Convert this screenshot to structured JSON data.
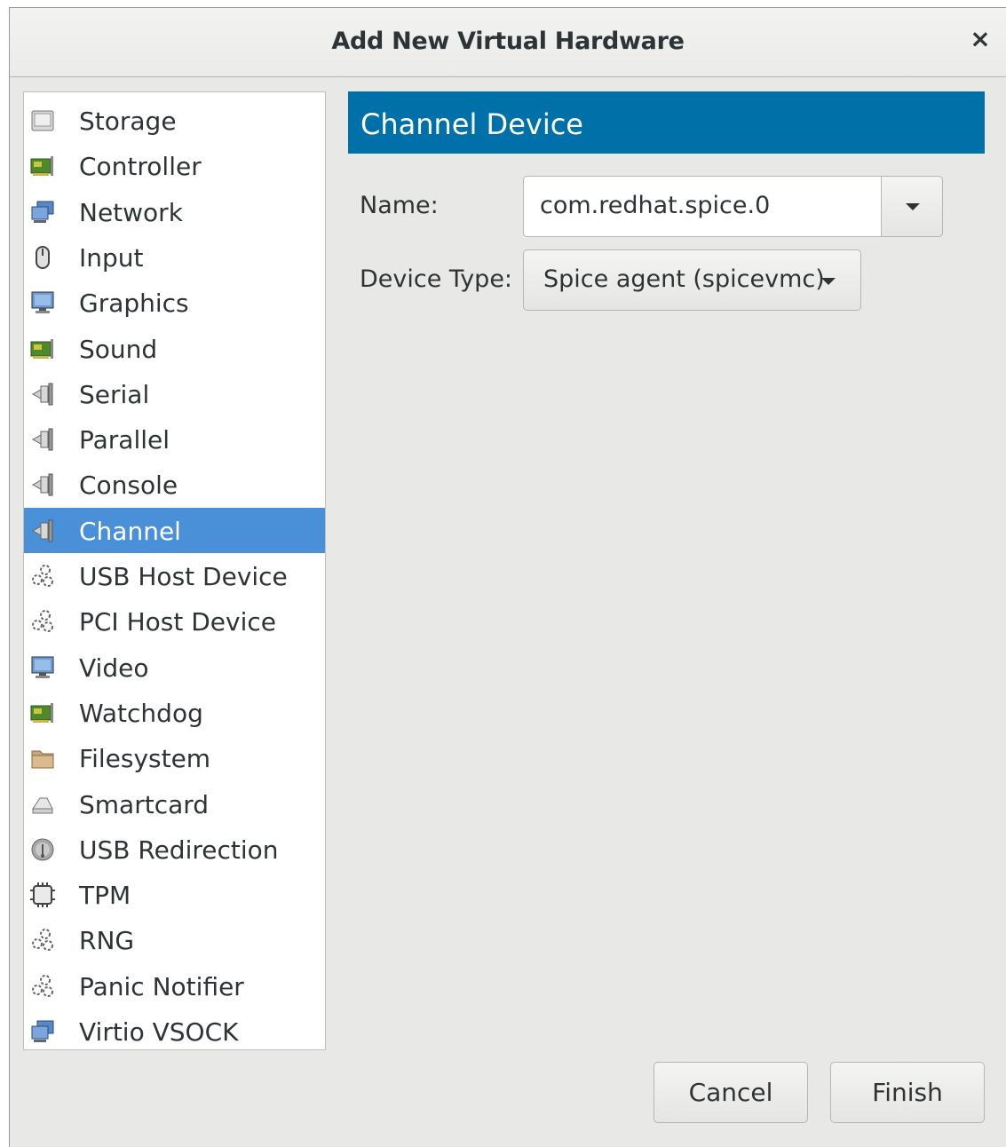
{
  "window": {
    "title": "Add New Virtual Hardware",
    "close_glyph": "×"
  },
  "hardware_list": {
    "selected_index": 9,
    "items": [
      {
        "label": "Storage",
        "icon": "disk-icon"
      },
      {
        "label": "Controller",
        "icon": "card-icon"
      },
      {
        "label": "Network",
        "icon": "network-icon"
      },
      {
        "label": "Input",
        "icon": "mouse-icon"
      },
      {
        "label": "Graphics",
        "icon": "monitor-icon"
      },
      {
        "label": "Sound",
        "icon": "card-icon"
      },
      {
        "label": "Serial",
        "icon": "plug-icon"
      },
      {
        "label": "Parallel",
        "icon": "plug-icon"
      },
      {
        "label": "Console",
        "icon": "plug-icon"
      },
      {
        "label": "Channel",
        "icon": "plug-icon"
      },
      {
        "label": "USB Host Device",
        "icon": "gears-icon"
      },
      {
        "label": "PCI Host Device",
        "icon": "gears-icon"
      },
      {
        "label": "Video",
        "icon": "monitor-icon"
      },
      {
        "label": "Watchdog",
        "icon": "card-icon"
      },
      {
        "label": "Filesystem",
        "icon": "folder-icon"
      },
      {
        "label": "Smartcard",
        "icon": "card-reader-icon"
      },
      {
        "label": "USB Redirection",
        "icon": "usb-icon"
      },
      {
        "label": "TPM",
        "icon": "chip-icon"
      },
      {
        "label": "RNG",
        "icon": "gears-icon"
      },
      {
        "label": "Panic Notifier",
        "icon": "gears-icon"
      },
      {
        "label": "Virtio VSOCK",
        "icon": "network-icon"
      }
    ]
  },
  "details": {
    "header": "Channel Device",
    "name_label": "Name:",
    "name_value": "com.redhat.spice.0",
    "device_type_label": "Device Type:",
    "device_type_value": "Spice agent (spicevmc)"
  },
  "buttons": {
    "cancel": "Cancel",
    "finish": "Finish"
  },
  "colors": {
    "selection": "#4a90d9",
    "header_bg": "#0071a8",
    "window_bg": "#e8e8e7"
  }
}
